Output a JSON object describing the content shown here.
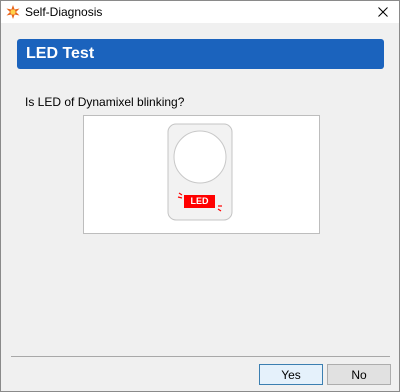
{
  "window": {
    "title": "Self-Diagnosis"
  },
  "banner": {
    "title": "LED Test"
  },
  "question": "Is LED of Dynamixel blinking?",
  "illustration": {
    "led_label": "LED",
    "led_color": "#ff0000"
  },
  "buttons": {
    "yes_label": "Yes",
    "no_label": "No"
  },
  "colors": {
    "banner": "#1b63bd",
    "window_bg": "#f0f0f0"
  }
}
